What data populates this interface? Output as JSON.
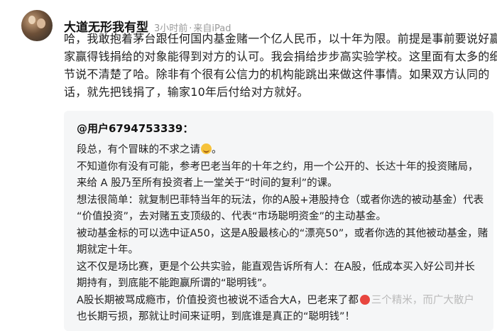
{
  "post": {
    "username": "大道无形我有型",
    "time": "3小时前",
    "source": "来自iPad",
    "text_lines": [
      "哈，我敢抱着茅台跟任何国内基金赌一个亿人民币，以十年为限。前提是事前要说好赢",
      "家赢得钱捐给的对象能得到对方的认可。我会捐给步步高实验学校。这里面有太多的细",
      "节说不清楚了哈。除非有个很有公信力的机构能跳出来做这件事情。如果双方认同的",
      "话，就先把钱捐了，输家10年后付给对方就好。"
    ]
  },
  "quote": {
    "author": "@用户6794753339：",
    "greeting": "段总，有个冒昧的不求之请",
    "greeting_end": "。",
    "lines": [
      "不知道你有没有可能，参考巴老当年的十年之约，用一个公开的、长达十年的投资赌局，",
      "来给 A 股乃至所有投资者上一堂关于“时间的复利”的课。",
      "想法很简单：就复制巴菲特当年的玩法，你的A股+港股持仓（或者你选的被动基金）代表",
      "“价值投资”，去对赌五支顶级的、代表“市场聪明资金”的主动基金。",
      "被动基金标的可以选中证A50，这是A股最核心的“漂亮50”，或者你选的其他被动基金，赌",
      "期就定十年。",
      "这不仅是场比赛，更是个公共实验，能直观告诉所有人：在A股，低成本买入好公司并长",
      "期持有，到底能不能跑赢所谓的“聪明钱”。"
    ],
    "last_line_a": "A股长期被骂成瘾市，价值投资也被说不适合大A，巴老来了都",
    "last_line_b": "三个精米，而广大散户",
    "final_line": "也长期亏损，那就让时间来证明，到底谁是真正的“聪明钱”！"
  },
  "colors": {
    "username": "#111111",
    "meta": "#999999",
    "quote_bg": "#f5f6f7"
  }
}
